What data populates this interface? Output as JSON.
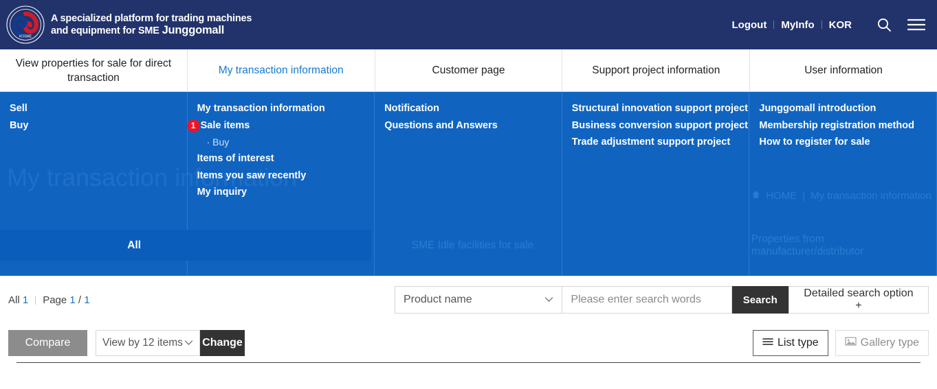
{
  "header": {
    "logo_icon": "kosme-korea-sme-agency-logo",
    "tagline_line1": "A specialized platform for trading machines",
    "tagline_line2": "and equipment for SME",
    "brand_name": "Junggomall",
    "links": [
      {
        "label": "Logout",
        "name": "logout-link"
      },
      {
        "label": "MyInfo",
        "name": "myinfo-link"
      },
      {
        "label": "KOR",
        "name": "language-kor-link"
      }
    ],
    "search_icon": "search-icon",
    "menu_icon": "hamburger-menu-icon",
    "bg_color": "#22336b"
  },
  "nav": {
    "items": [
      {
        "label": "View properties for sale for direct transaction",
        "active": false,
        "name": "nav-direct-transaction"
      },
      {
        "label": "My transaction information",
        "active": true,
        "name": "nav-my-transaction-information"
      },
      {
        "label": "Customer page",
        "active": false,
        "name": "nav-customer-page"
      },
      {
        "label": "Support project information",
        "active": false,
        "name": "nav-support-project-information"
      },
      {
        "label": "User information",
        "active": false,
        "name": "nav-user-information"
      }
    ],
    "active_color": "#1779d0"
  },
  "mega_menu": {
    "bg_color": "#1064c0",
    "ghost_title": "My transaction information",
    "breadcrumb": {
      "home_icon": "home-icon",
      "home_label": "HOME",
      "separator": "|",
      "current": "My transaction information"
    },
    "columns": [
      {
        "name": "mega-col-direct-transaction",
        "links": [
          {
            "label": "Sell",
            "badge": null,
            "sub": false
          },
          {
            "label": "Buy",
            "badge": null,
            "sub": false
          }
        ]
      },
      {
        "name": "mega-col-my-transaction",
        "links": [
          {
            "label": "My transaction information",
            "badge": null,
            "sub": false
          },
          {
            "label": "Sale items",
            "badge": "1",
            "sub": false
          },
          {
            "label": "Buy",
            "badge": null,
            "sub": true
          },
          {
            "label": "Items of interest",
            "badge": null,
            "sub": false
          },
          {
            "label": "Items you saw recently",
            "badge": null,
            "sub": false
          },
          {
            "label": "My inquiry",
            "badge": null,
            "sub": false
          }
        ]
      },
      {
        "name": "mega-col-customer-page",
        "links": [
          {
            "label": "Notification",
            "badge": null,
            "sub": false
          },
          {
            "label": "Questions and Answers",
            "badge": null,
            "sub": false
          }
        ]
      },
      {
        "name": "mega-col-support-project",
        "links": [
          {
            "label": "Structural innovation support project",
            "badge": null,
            "sub": false
          },
          {
            "label": "Business conversion support project",
            "badge": null,
            "sub": false
          },
          {
            "label": "Trade adjustment support project",
            "badge": null,
            "sub": false
          }
        ]
      },
      {
        "name": "mega-col-user-information",
        "links": [
          {
            "label": "Junggomall introduction",
            "badge": null,
            "sub": false
          },
          {
            "label": "Membership registration method",
            "badge": null,
            "sub": false
          },
          {
            "label": "How to register for sale",
            "badge": null,
            "sub": false
          }
        ]
      }
    ],
    "band": {
      "cells": [
        {
          "label": "All",
          "state": "selected"
        },
        {
          "label": "",
          "state": "selected-empty"
        },
        {
          "label": "SME Idle facilities for sale",
          "state": "ghost"
        },
        {
          "label": "",
          "state": "ghost-empty"
        },
        {
          "label": "Properties from manufacturer/distributor",
          "state": "ghost"
        }
      ],
      "selected_color": "#0a5dbb"
    }
  },
  "results": {
    "all_label": "All",
    "all_count": "1",
    "page_label": "Page",
    "page_current": "1",
    "page_divider": "/",
    "page_total": "1"
  },
  "search": {
    "category_value": "Product name",
    "chevron_icon": "chevron-down-icon",
    "input_placeholder": "Please enter search words",
    "input_value": "",
    "search_button": "Search",
    "detailed_button": "Detailed search option +"
  },
  "toolbar": {
    "compare_label": "Compare",
    "view_value": "View by 12 items",
    "view_chevron_icon": "chevron-down-icon",
    "change_label": "Change",
    "list_type_label": "List type",
    "list_type_icon": "list-lines-icon",
    "gallery_type_label": "Gallery type",
    "gallery_type_icon": "image-gallery-icon",
    "active_view": "list"
  }
}
